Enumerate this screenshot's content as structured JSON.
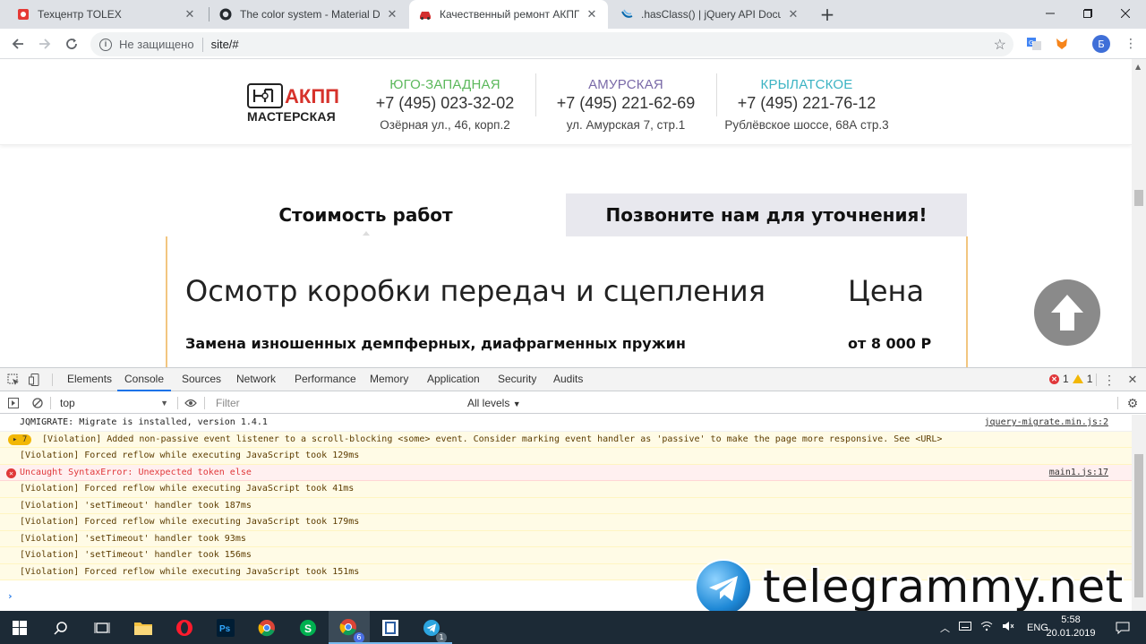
{
  "browser": {
    "tabs": [
      {
        "title": "Техцентр TOLEX",
        "favicon": "red-square-icon",
        "active": false
      },
      {
        "title": "The color system - Material Desig",
        "favicon": "github-icon",
        "active": false
      },
      {
        "title": "Качественный ремонт АКПП в М",
        "favicon": "car-icon",
        "active": true
      },
      {
        "title": ".hasClass() | jQuery API Documen",
        "favicon": "jquery-icon",
        "active": false
      }
    ],
    "new_tab": "+",
    "omnibox": {
      "security_label": "Не защищено",
      "url": "site/#"
    },
    "profile_initial": "Б",
    "colors": {
      "tabstrip": "#dee1e6",
      "active_tab": "#ffffff",
      "omnibox": "#f1f3f4"
    }
  },
  "site": {
    "logo": {
      "line1": "АКПП",
      "line2": "МАСТЕРСКАЯ"
    },
    "branches": [
      {
        "name": "ЮГО-ЗАПАДНАЯ",
        "phone": "+7 (495) 023-32-02",
        "address": "Озёрная ул., 46, корп.2",
        "color": "#5cb85c"
      },
      {
        "name": "АМУРСКАЯ",
        "phone": "+7 (495) 221-62-69",
        "address": "ул. Амурская 7, стр.1",
        "color": "#7a6aa8"
      },
      {
        "name": "КРЫЛАТСКОЕ",
        "phone": "+7 (495) 221-76-12",
        "address": "Рублёвское шоссе, 68А стр.3",
        "color": "#3bb3c3"
      }
    ],
    "tabs": {
      "price": "Стоимость работ",
      "call": "Позвоните нам для уточнения!"
    },
    "price_table": {
      "heading": "Осмотр коробки передач и сцепления",
      "price_heading": "Цена",
      "rows": [
        {
          "name": "Замена изношенных демпферных, диафрагменных пружин",
          "price": "от 8 000 Р"
        }
      ]
    },
    "colors": {
      "price_box_border": "#f2c680",
      "call_tab_bg": "#e8e8ee",
      "scroll_top_btn": "#8a8a8a"
    }
  },
  "devtools": {
    "tabs": [
      "Elements",
      "Console",
      "Sources",
      "Network",
      "Performance",
      "Memory",
      "Application",
      "Security",
      "Audits"
    ],
    "active_tab": "Console",
    "error_count": "1",
    "warning_count": "1",
    "context": "top",
    "filter_placeholder": "Filter",
    "levels": "All levels",
    "messages": [
      {
        "level": "info",
        "text": "JQMIGRATE: Migrate is installed, version 1.4.1",
        "source": "jquery-migrate.min.js:2"
      },
      {
        "level": "warn",
        "badge": "7",
        "text": "[Violation] Added non-passive event listener to a scroll-blocking <some> event. Consider marking event handler as 'passive' to make the page more responsive. See <URL>",
        "source": ""
      },
      {
        "level": "warn",
        "text": "[Violation] Forced reflow while executing JavaScript took 129ms",
        "source": ""
      },
      {
        "level": "error",
        "text": "Uncaught SyntaxError: Unexpected token else",
        "source": "main1.js:17"
      },
      {
        "level": "warn",
        "text": "[Violation] Forced reflow while executing JavaScript took 41ms",
        "source": ""
      },
      {
        "level": "warn",
        "text": "[Violation] 'setTimeout' handler took 187ms",
        "source": ""
      },
      {
        "level": "warn",
        "text": "[Violation] Forced reflow while executing JavaScript took 179ms",
        "source": ""
      },
      {
        "level": "warn",
        "text": "[Violation] 'setTimeout' handler took 93ms",
        "source": ""
      },
      {
        "level": "warn",
        "text": "[Violation] 'setTimeout' handler took 156ms",
        "source": ""
      },
      {
        "level": "warn",
        "text": "[Violation] Forced reflow while executing JavaScript took 151ms",
        "source": ""
      }
    ],
    "prompt": "›",
    "colors": {
      "accent": "#1a73e8",
      "error": "#e0373a",
      "warning": "#f2b705"
    }
  },
  "watermark": {
    "text": "telegrammy.net"
  },
  "taskbar": {
    "apps": [
      "windows-start-icon",
      "search-icon",
      "task-view-icon",
      "file-explorer-icon",
      "opera-icon",
      "photoshop-icon",
      "chrome-icon",
      "skype-icon",
      "chrome-devtools-icon",
      "app-icon",
      "telegram-icon"
    ],
    "chrome_badge": "6",
    "telegram_badge": "1",
    "language": "ENG",
    "time": "5:58",
    "date": "20.01.2019"
  }
}
